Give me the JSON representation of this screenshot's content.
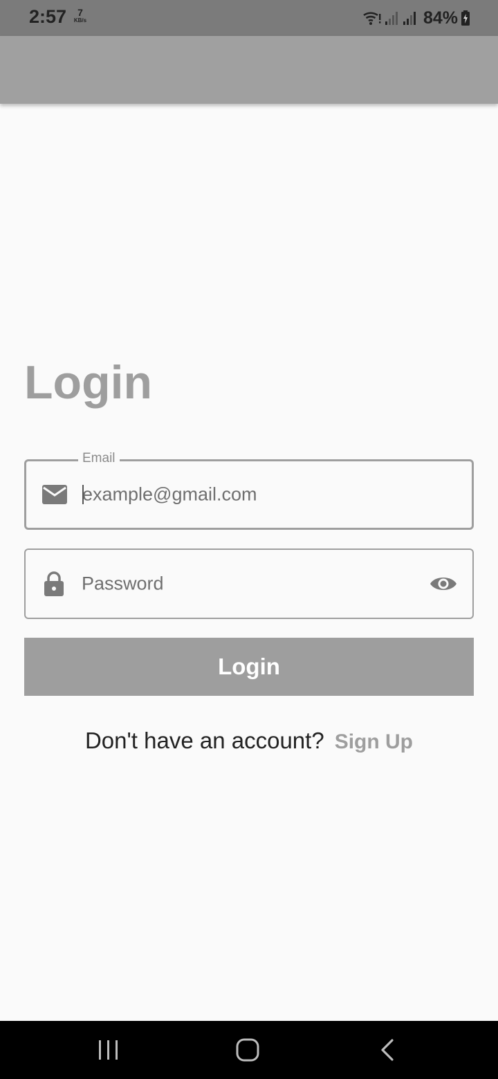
{
  "status_bar": {
    "time": "2:57",
    "net_speed_value": "7",
    "net_speed_unit": "KB/s",
    "battery_percent": "84%",
    "icons": [
      "wifi-icon",
      "signal-icon",
      "signal-icon",
      "battery-charging-icon"
    ]
  },
  "app_bar": {
    "title": ""
  },
  "main": {
    "title": "Login",
    "email_field": {
      "label": "Email",
      "placeholder": "example@gmail.com",
      "value": "",
      "icon": "mail-icon"
    },
    "password_field": {
      "placeholder": "Password",
      "value": "",
      "icon": "lock-icon",
      "toggle_icon": "eye-icon"
    },
    "login_button_label": "Login",
    "signup_prompt": "Don't have an account?",
    "signup_link": "Sign Up"
  },
  "nav_bar": {
    "buttons": [
      "recents-icon",
      "home-icon",
      "back-icon"
    ]
  },
  "colors": {
    "status_bar": "#7b7b7b",
    "app_bar": "#a0a0a0",
    "primary": "#9e9e9e",
    "background": "#fafafa",
    "nav_bar": "#000000"
  }
}
